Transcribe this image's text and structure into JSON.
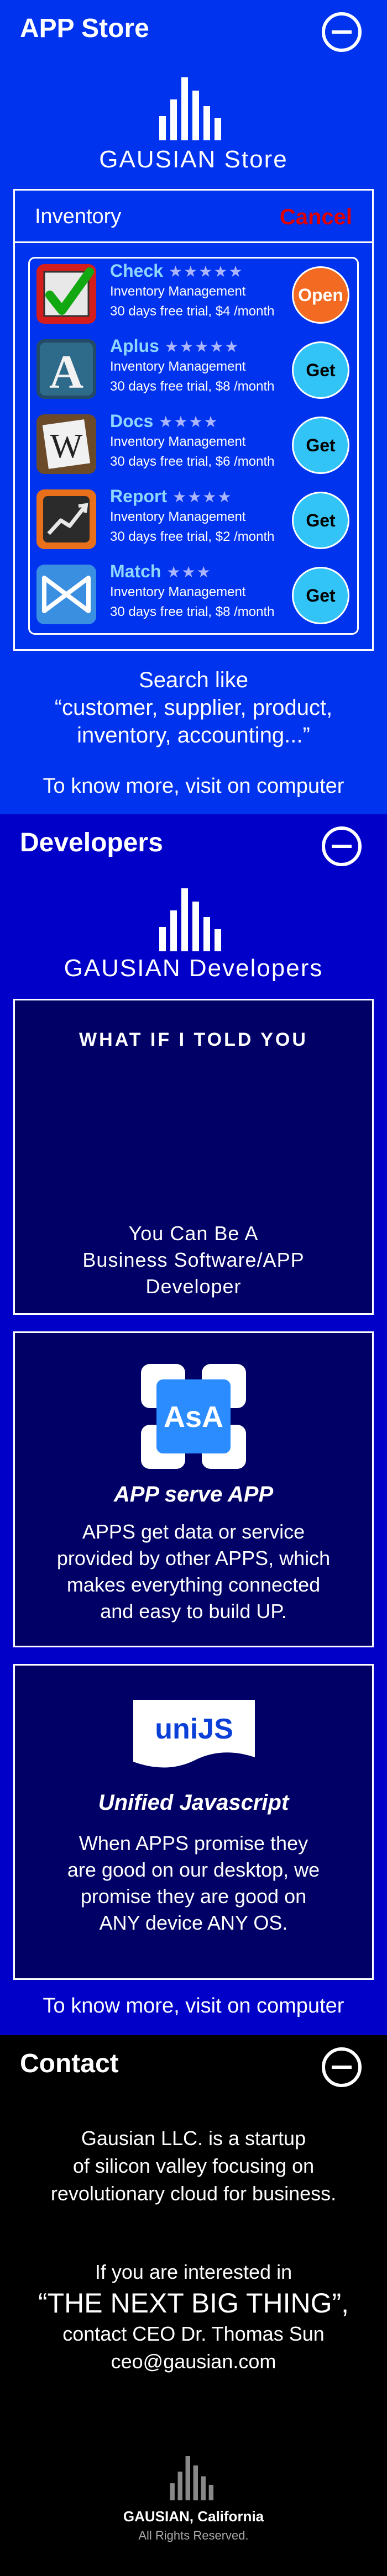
{
  "appstore": {
    "title": "APP Store",
    "brand": "GAUSIAN Store",
    "inventory_title": "Inventory",
    "cancel_label": "Cancel",
    "apps": [
      {
        "name": "Check",
        "stars": "★★★★★",
        "category": "Inventory Management",
        "trial": "30 days free trial, $4 /month",
        "button": "Open",
        "icon": "check-icon"
      },
      {
        "name": "Aplus",
        "stars": "★★★★★",
        "category": "Inventory Management",
        "trial": "30 days free trial, $8 /month",
        "button": "Get",
        "icon": "letter-a-icon"
      },
      {
        "name": "Docs",
        "stars": "★★★★",
        "category": "Inventory Management",
        "trial": "30 days free trial, $6 /month",
        "button": "Get",
        "icon": "letter-w-icon"
      },
      {
        "name": "Report",
        "stars": "★★★★",
        "category": "Inventory Management",
        "trial": "30 days free trial, $2 /month",
        "button": "Get",
        "icon": "chart-icon"
      },
      {
        "name": "Match",
        "stars": "★★★",
        "category": "Inventory Management",
        "trial": "30 days free trial, $8 /month",
        "button": "Get",
        "icon": "match-icon"
      }
    ],
    "search_line1": "Search like",
    "search_line2": "“customer, supplier, product,",
    "search_line3": "inventory, accounting...”",
    "more": "To know more, visit on computer"
  },
  "developers": {
    "title": "Developers",
    "brand": "GAUSIAN Developers",
    "card1_heading": "WHAT IF I TOLD YOU",
    "card1_line1": "You Can Be A",
    "card1_line2": "Business Software/APP",
    "card1_line3": "Developer",
    "card2_logo": "AsA",
    "card2_title": "APP serve APP",
    "card2_line1": "APPS get data or service",
    "card2_line2": "provided by other APPS, which",
    "card2_line3": "makes everything connected",
    "card2_line4": "and easy to build UP.",
    "card3_logo": "uniJS",
    "card3_title": "Unified Javascript",
    "card3_line1": "When APPS promise they",
    "card3_line2": "are good on our desktop, we",
    "card3_line3": "promise they are good on",
    "card3_line4": "ANY device ANY OS.",
    "more": "To know more, visit on computer"
  },
  "contact": {
    "title": "Contact",
    "line1": "Gausian LLC. is a startup",
    "line2": "of silicon valley focusing on",
    "line3": "revolutionary cloud for business.",
    "line4": "If you are interested in",
    "line5": "“THE NEXT BIG THING”,",
    "line6": "contact CEO Dr. Thomas Sun",
    "line7": "ceo@gausian.com",
    "footer_company": "GAUSIAN, California",
    "footer_rights": "All Rights Reserved."
  },
  "colors": {
    "appstore_bg": "#0033ee",
    "developers_bg": "#0000c8",
    "card_bg": "#000066",
    "cancel": "#e00000",
    "open_button": "#f36a22",
    "get_button": "#33c4f7",
    "app_name": "#8fd6ff"
  }
}
